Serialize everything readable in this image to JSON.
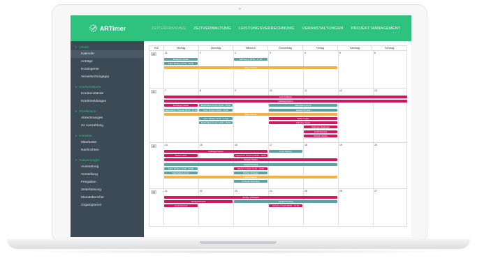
{
  "colors": {
    "brand": "#2ec27e",
    "sidebar": "#3c4a55",
    "event_pink": "#d1185f",
    "event_teal": "#5aa3a2",
    "event_orange": "#f2b241"
  },
  "app": {
    "name": "ARTimer",
    "logo_icon": "clock-check-icon"
  },
  "nav": [
    {
      "label": "ZEITERFASSUNG",
      "active": true
    },
    {
      "label": "ZEITVERWALTUNG",
      "active": false
    },
    {
      "label": "LEISTUNGSVERRECHNUNG",
      "active": false
    },
    {
      "label": "VERANSTALTUNGEN",
      "active": false
    },
    {
      "label": "PROJEKT MANAGEMENT",
      "active": false
    }
  ],
  "sidebar": {
    "sections": [
      {
        "title": "Urlaub",
        "items": [
          {
            "label": "Kalender",
            "active": true
          },
          {
            "label": "Anträge"
          },
          {
            "label": "Kontingente"
          },
          {
            "label": "Verantwortungsgrp"
          }
        ]
      },
      {
        "title": "Krankenstände",
        "items": [
          {
            "label": "Krankenstände"
          },
          {
            "label": "Krankmeldungen"
          }
        ]
      },
      {
        "title": "Provisionen",
        "items": [
          {
            "label": "Abrechnungen"
          },
          {
            "label": "ZA Auszahlung"
          }
        ]
      },
      {
        "title": "Kontakte",
        "items": [
          {
            "label": "Mitarbeiter"
          },
          {
            "label": "Nachrichten"
          }
        ]
      },
      {
        "title": "Auswertungen",
        "items": [
          {
            "label": "Ausstattung"
          },
          {
            "label": "Vorstellung"
          },
          {
            "label": "Freigaben"
          },
          {
            "label": "Zeiterfassung"
          },
          {
            "label": "Monatsberichte"
          },
          {
            "label": "Organigramm"
          }
        ]
      }
    ]
  },
  "calendar": {
    "columns": [
      "KW",
      "Montag",
      "Dienstag",
      "Mittwoch",
      "Donnerstag",
      "Freitag",
      "Samstag",
      "Sonntag"
    ],
    "weeks": [
      {
        "kw": "40",
        "days": [
          "31",
          "1",
          "2",
          "3",
          "4",
          "5",
          "6"
        ],
        "events": [
          {
            "label": "Deutsche Stefan",
            "color": "teal",
            "start": 0,
            "span": 1,
            "row": 0
          },
          {
            "label": "Kuhn Markus 12:00 - 16:00",
            "color": "teal",
            "start": 0,
            "span": 1,
            "row": 1
          },
          {
            "label": "Still Georg 18:00 - 17:00",
            "color": "teal",
            "start": 2,
            "span": 1,
            "row": 0
          },
          {
            "label": "Maus Patrick",
            "color": "orange",
            "start": 0,
            "span": 5,
            "row": 2
          }
        ]
      },
      {
        "kw": "41",
        "days": [
          "7",
          "8",
          "9",
          "10",
          "11",
          "12",
          "13"
        ],
        "events": [
          {
            "label": "Auer Andreas",
            "color": "pink",
            "start": 0,
            "span": 7,
            "row": 0
          },
          {
            "label": "Hoffnagl Florian",
            "color": "pink",
            "start": 0,
            "span": 7,
            "row": 1
          },
          {
            "label": "Rotzlinger David",
            "color": "pink",
            "start": 0,
            "span": 1,
            "row": 2
          },
          {
            "label": "Mattmüllers Armin 09:00 - 16:00",
            "color": "teal",
            "start": 1,
            "span": 1,
            "row": 2
          },
          {
            "label": "Mattmüllers Armin",
            "color": "teal",
            "start": 3,
            "span": 2,
            "row": 2
          },
          {
            "label": "Hagenleitner Thomas 09:00 - 17:00",
            "color": "teal",
            "start": 0,
            "span": 1,
            "row": 3
          },
          {
            "label": "Kuhn Markus 09:00 - 15:00",
            "color": "teal",
            "start": 1,
            "span": 1,
            "row": 3
          },
          {
            "label": "Harald Dominik",
            "color": "teal",
            "start": 3,
            "span": 2,
            "row": 3
          },
          {
            "label": "Maus Patrick",
            "color": "orange",
            "start": 0,
            "span": 5,
            "row": 4
          },
          {
            "label": "Kuhn Markus 11:00 - 17:00",
            "color": "teal",
            "start": 1,
            "span": 1,
            "row": 5
          },
          {
            "label": "Reiter Lukas",
            "color": "pink",
            "start": 3,
            "span": 2,
            "row": 5
          },
          {
            "label": "Mattmüllers Armin 14:00 - 15:00",
            "color": "teal",
            "start": 1,
            "span": 1,
            "row": 6
          },
          {
            "label": "Zehetner Noah",
            "color": "pink",
            "start": 3,
            "span": 2,
            "row": 6
          },
          {
            "label": "Gallinger Raphaela",
            "color": "pink",
            "start": 4,
            "span": 1,
            "row": 7
          },
          {
            "label": "Jandl Dominic",
            "color": "pink",
            "start": 4,
            "span": 1,
            "row": 8
          },
          {
            "label": "Winkler Stefan",
            "color": "pink",
            "start": 4,
            "span": 1,
            "row": 9
          }
        ]
      },
      {
        "kw": "42",
        "days": [
          "14",
          "15",
          "16",
          "17",
          "18",
          "19",
          "20"
        ],
        "events": [
          {
            "label": "Hoffnagl Florian",
            "color": "pink",
            "start": 0,
            "span": 3,
            "row": 0
          },
          {
            "label": "Kuhn Markus",
            "color": "teal",
            "start": 3,
            "span": 1,
            "row": 0
          },
          {
            "label": "Reiter Lukas",
            "color": "pink",
            "start": 0,
            "span": 1,
            "row": 1
          },
          {
            "label": "Ingelmann Hannes 09:00 - 18:00",
            "color": "pink",
            "start": 2,
            "span": 1,
            "row": 1
          },
          {
            "label": "Winkler Stefan",
            "color": "pink",
            "start": 0,
            "span": 5,
            "row": 2
          },
          {
            "label": "Harald Dominik",
            "color": "teal",
            "start": 0,
            "span": 5,
            "row": 3
          },
          {
            "label": "Kuhn Markus 14:30 - 17:00",
            "color": "teal",
            "start": 0,
            "span": 1,
            "row": 4
          },
          {
            "label": "Zehetner Noah 11:30 - 13:30",
            "color": "pink",
            "start": 2,
            "span": 1,
            "row": 4
          },
          {
            "label": "Mattmüllers Armin",
            "color": "teal",
            "start": 0,
            "span": 1,
            "row": 5
          },
          {
            "label": "Pichler Christian",
            "color": "teal",
            "start": 2,
            "span": 1,
            "row": 5
          },
          {
            "label": "Maus Patrick",
            "color": "orange",
            "start": 0,
            "span": 5,
            "row": 6
          },
          {
            "label": "Pocholitz Roswitha",
            "color": "teal",
            "start": 2,
            "span": 1,
            "row": 7
          }
        ]
      },
      {
        "kw": "43",
        "days": [
          "21",
          "22",
          "23",
          "24",
          "25",
          "26",
          "27"
        ],
        "events": [
          {
            "label": "Richter Christoph",
            "color": "pink",
            "start": 0,
            "span": 5,
            "row": 0
          },
          {
            "label": "Harald Dominik",
            "color": "pink",
            "start": 0,
            "span": 2,
            "row": 1
          },
          {
            "label": "Harald Dominik",
            "color": "teal",
            "start": 2,
            "span": 3,
            "row": 1
          },
          {
            "label": "Jandl Dominic",
            "color": "pink",
            "start": 0,
            "span": 1,
            "row": 2
          },
          {
            "label": "Zehetner Noah 08:00 - 12:00",
            "color": "pink",
            "start": 3,
            "span": 1,
            "row": 2
          }
        ]
      }
    ]
  }
}
